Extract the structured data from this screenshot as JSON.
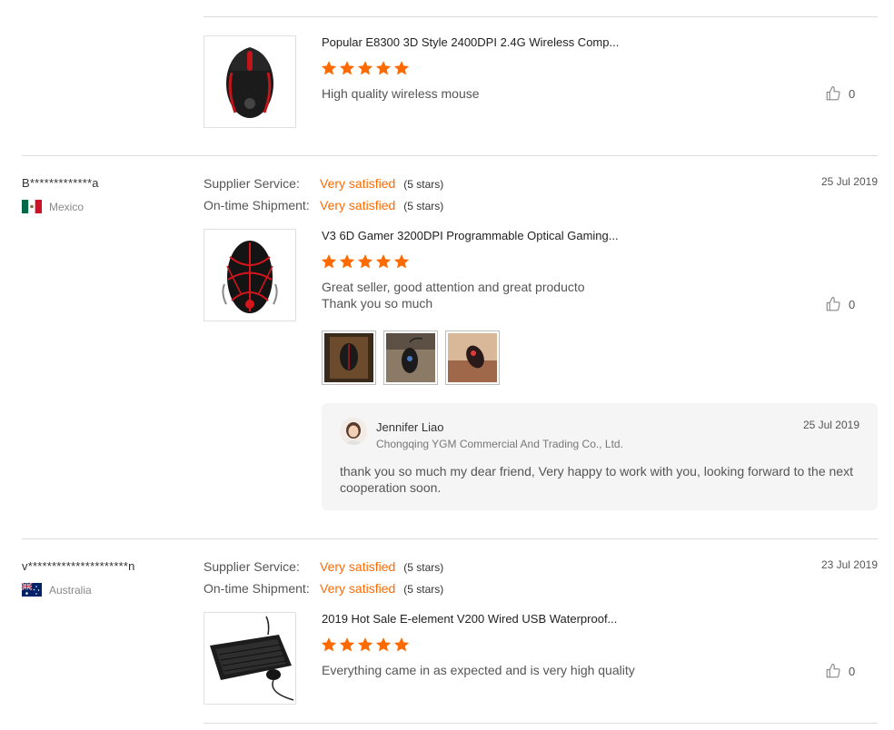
{
  "reviews": [
    {
      "product": {
        "title": "Popular E8300 3D Style 2400DPI 2.4G Wireless Comp...",
        "image": "black-red-wireless-mouse"
      },
      "stars": 5,
      "text": "High quality wireless mouse",
      "likes": "0"
    },
    {
      "buyer": {
        "name": "B*************a",
        "country": "Mexico"
      },
      "supplier_service": {
        "label": "Supplier Service:",
        "value": "Very satisfied",
        "stars": "(5 stars)"
      },
      "shipment": {
        "label": "On-time Shipment:",
        "value": "Very satisfied",
        "stars": "(5 stars)"
      },
      "date": "25 Jul 2019",
      "product": {
        "title": "V3 6D Gamer 3200DPI Programmable Optical Gaming...",
        "image": "black-red-gaming-mouse"
      },
      "stars": 5,
      "text_line1": "Great seller, good attention and great producto",
      "text_line2": "Thank you so much",
      "likes": "0",
      "photos": [
        "buyer-photo-1",
        "buyer-photo-2",
        "buyer-photo-3"
      ],
      "reply": {
        "name": "Jennifer Liao",
        "company": "Chongqing YGM Commercial And Trading Co., Ltd.",
        "date": "25 Jul 2019",
        "text": "thank you so much my dear friend, Very happy to work with you, looking forward to the next cooperation soon."
      }
    },
    {
      "buyer": {
        "name": "v*********************n",
        "country": "Australia"
      },
      "supplier_service": {
        "label": "Supplier Service:",
        "value": "Very satisfied",
        "stars": "(5 stars)"
      },
      "shipment": {
        "label": "On-time Shipment:",
        "value": "Very satisfied",
        "stars": "(5 stars)"
      },
      "date": "23 Jul 2019",
      "product": {
        "title": "2019 Hot Sale E-element V200 Wired USB Waterproof...",
        "image": "black-keyboard-mouse-combo"
      },
      "stars": 5,
      "text": "Everything came in as expected and is very high quality",
      "likes": "0"
    }
  ],
  "colors": {
    "accent": "#ff6a00",
    "divider": "#dcdcdc",
    "reply_bg": "#f5f5f5"
  }
}
